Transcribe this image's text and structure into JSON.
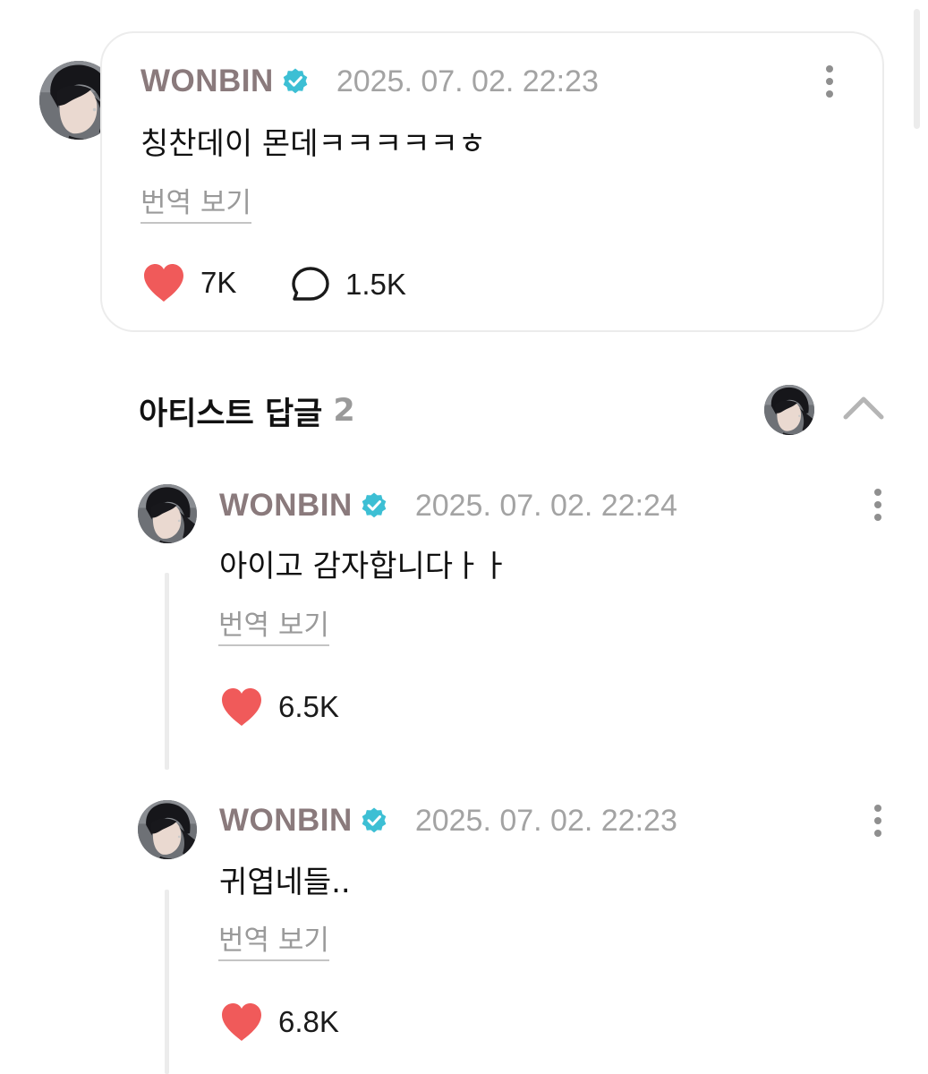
{
  "post": {
    "author": "WONBIN",
    "timestamp": "2025. 07. 02. 22:23",
    "text": "칭찬데이 몬데ㅋㅋㅋㅋㅋㅎ",
    "translate_label": "번역 보기",
    "likes": "7K",
    "comments": "1.5K"
  },
  "artist_replies": {
    "title": "아티스트 답글",
    "count": "2",
    "replies": [
      {
        "author": "WONBIN",
        "timestamp": "2025. 07. 02. 22:24",
        "text": "아이고 감자합니다ㅏㅏ",
        "translate_label": "번역 보기",
        "likes": "6.5K"
      },
      {
        "author": "WONBIN",
        "timestamp": "2025. 07. 02. 22:23",
        "text": "귀엽네들..",
        "translate_label": "번역 보기",
        "likes": "6.8K"
      }
    ]
  },
  "icons": {
    "verified": "verified-badge-icon",
    "more": "more-vertical-icon",
    "like": "heart-icon",
    "comment": "comment-bubble-icon",
    "collapse": "chevron-up-icon"
  },
  "colors": {
    "author_name": "#8a7a7c",
    "verified_badge": "#3dbfd4",
    "heart": "#f05a5a",
    "timestamp": "#a3a3a3",
    "card_border": "#ececec"
  }
}
